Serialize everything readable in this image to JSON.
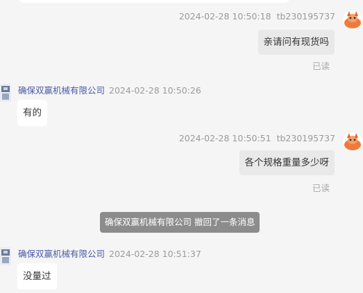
{
  "messages": [
    {
      "side": "right",
      "time": "2024-02-28 10:50:18",
      "sender": "tb230195737",
      "text": "亲请问有现货吗",
      "status": "已读"
    },
    {
      "side": "left",
      "sender": "确保双赢机械有限公司",
      "time": "2024-02-28 10:50:26",
      "text": "有的"
    },
    {
      "side": "right",
      "time": "2024-02-28 10:50:51",
      "sender": "tb230195737",
      "text": "各个规格重量多少呀",
      "status": "已读"
    },
    {
      "side": "left",
      "sender": "确保双赢机械有限公司",
      "time": "2024-02-28 10:51:37",
      "text": "没量过"
    }
  ],
  "system_notice": "确保双赢机械有限公司 撤回了一条消息",
  "colors": {
    "background": "#f5f5f5",
    "shop_name": "#4a5aa8",
    "self_bubble": "#e9e9e9",
    "shop_bubble": "#ffffff",
    "notice_bg": "#8c8c8c",
    "avatar_orange": "#f07a3c"
  },
  "icons": {
    "self_avatar": "orange-cartoon-avatar-icon",
    "shop_avatar": "shop-avatar-icon"
  }
}
